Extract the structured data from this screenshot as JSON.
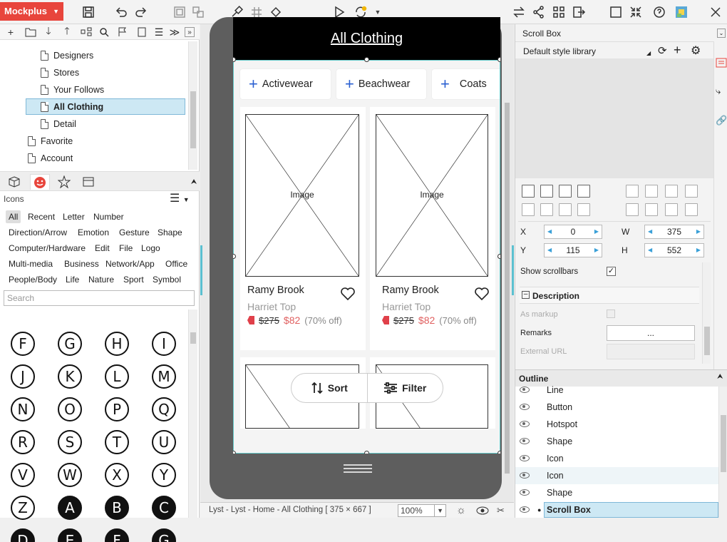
{
  "app": {
    "logo": "Mockplus"
  },
  "tree": {
    "items": [
      {
        "label": "Designers"
      },
      {
        "label": "Stores"
      },
      {
        "label": "Your Follows"
      },
      {
        "label": "All Clothing"
      },
      {
        "label": "Detail"
      },
      {
        "label": "Favorite"
      },
      {
        "label": "Account"
      }
    ]
  },
  "icons_panel": {
    "title": "Icons",
    "categories": [
      "All",
      "Recent",
      "Letter",
      "Number",
      "Direction/Arrow",
      "Emotion",
      "Gesture",
      "Shape",
      "Computer/Hardware",
      "Edit",
      "File",
      "Logo",
      "Multi-media",
      "Business",
      "Network/App",
      "Office",
      "People/Body",
      "Life",
      "Nature",
      "Sport",
      "Symbol"
    ],
    "search_placeholder": "Search",
    "letters": [
      "F",
      "G",
      "H",
      "I",
      "J",
      "K",
      "L",
      "M",
      "N",
      "O",
      "P",
      "Q",
      "R",
      "S",
      "T",
      "U",
      "V",
      "W",
      "X",
      "Y",
      "Z",
      "A",
      "B",
      "C",
      "D",
      "E",
      "F",
      "G"
    ]
  },
  "screen": {
    "header": "All Clothing",
    "chips": [
      "Activewear",
      "Beachwear",
      "Coats"
    ],
    "products": [
      {
        "image_label": "Image",
        "brand": "Ramy Brook",
        "name": "Harriet Top",
        "old_price": "$275",
        "new_price": "$82",
        "discount": "(70% off)"
      },
      {
        "image_label": "Image",
        "brand": "Ramy Brook",
        "name": "Harriet Top",
        "old_price": "$275",
        "new_price": "$82",
        "discount": "(70% off)"
      }
    ],
    "sort_label": "Sort",
    "filter_label": "Filter"
  },
  "statusbar": {
    "path": "Lyst - Lyst - Home - All Clothing [ 375 × 667 ]",
    "zoom": "100%"
  },
  "properties": {
    "title": "Scroll Box",
    "style_library": "Default style library",
    "x_label": "X",
    "x": "0",
    "y_label": "Y",
    "y": "115",
    "w_label": "W",
    "w": "375",
    "h_label": "H",
    "h": "552",
    "show_scrollbars": "Show scrollbars",
    "description": "Description",
    "as_markup": "As markup",
    "remarks": "Remarks",
    "remarks_value": "...",
    "external_url": "External URL"
  },
  "outline": {
    "title": "Outline",
    "items": [
      "Line",
      "Button",
      "Hotspot",
      "Shape",
      "Icon",
      "Icon",
      "Shape",
      "Scroll Box"
    ]
  },
  "colors": {
    "accent": "#e8453c",
    "selection": "#cde8f4",
    "brand_blue": "#2a5fd1",
    "fav_bg": "#fbd9d9"
  }
}
